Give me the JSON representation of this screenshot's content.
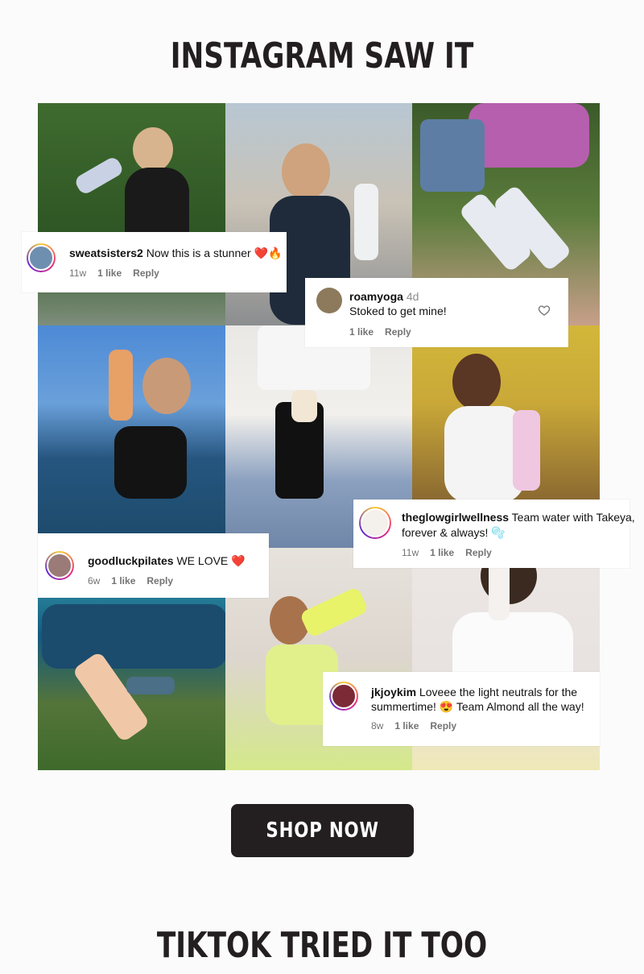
{
  "sections": {
    "instagram_heading": "INSTAGRAM SAW IT",
    "tiktok_heading": "TIKTOK TRIED IT TOO"
  },
  "cta": {
    "label": "SHOP NOW"
  },
  "comments": [
    {
      "user": "sweatsisters2",
      "text": "Now this is a stunner ❤️🔥",
      "age": "11w",
      "likes": "1 like",
      "reply": "Reply"
    },
    {
      "user": "roamyoga",
      "age_inline": "4d",
      "text": "Stoked to get mine!",
      "likes": "1 like",
      "reply": "Reply"
    },
    {
      "user": "theglowgirlwellness",
      "text": "Team water with Takeya,",
      "text2": "forever & always! 🫧",
      "age": "11w",
      "likes": "1 like",
      "reply": "Reply"
    },
    {
      "user": "goodluckpilates",
      "text": "WE LOVE ❤️",
      "age": "6w",
      "likes": "1 like",
      "reply": "Reply"
    },
    {
      "user": "jkjoykim",
      "text": "Loveee the light neutrals for the",
      "text2": "summertime! 😍 Team Almond all the way!",
      "age": "8w",
      "likes": "1 like",
      "reply": "Reply"
    }
  ],
  "icons": {
    "heart": "heart-outline-icon"
  },
  "colors": {
    "cta_bg": "#231f20",
    "heading": "#231f20",
    "meta_gray": "#737373"
  }
}
